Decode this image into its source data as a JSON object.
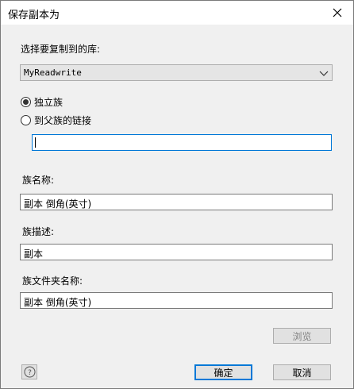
{
  "window": {
    "title": "保存副本为"
  },
  "library": {
    "label": "选择要复制到的库:",
    "selected": "MyReadwrite"
  },
  "family_type": {
    "options": [
      {
        "label": "独立族",
        "checked": true
      },
      {
        "label": "到父族的链接",
        "checked": false
      }
    ],
    "parent_link_value": ""
  },
  "family_name": {
    "label": "族名称:",
    "value": "副本 倒角(英寸)"
  },
  "family_description": {
    "label": "族描述:",
    "value": "副本"
  },
  "family_folder_name": {
    "label": "族文件夹名称:",
    "value": "副本 倒角(英寸)"
  },
  "buttons": {
    "browse": "浏览",
    "ok": "确定",
    "cancel": "取消"
  },
  "icons": {
    "close": "close-icon",
    "help": "help-icon",
    "dropdown": "chevron-down-icon"
  }
}
